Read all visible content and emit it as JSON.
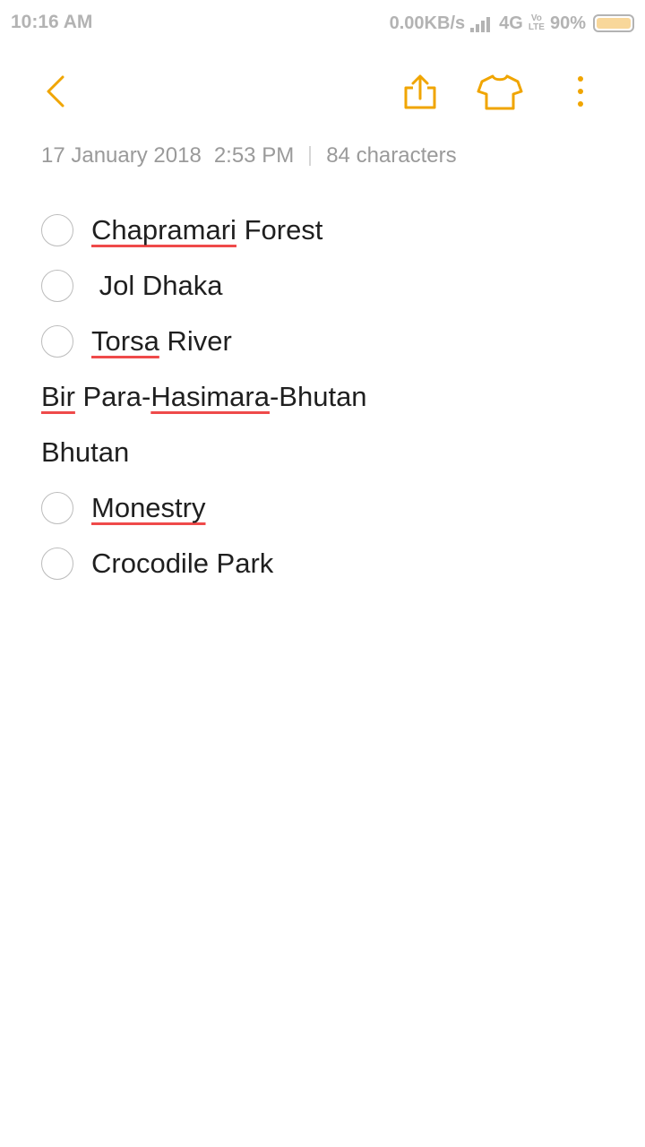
{
  "status_bar": {
    "time": "10:16 AM",
    "speed": "0.00KB/s",
    "network": "4G",
    "volte_top": "Vo",
    "volte_bottom": "LTE",
    "battery_percent": "90%",
    "battery_level": 0.9
  },
  "toolbar": {
    "icons": [
      "back-chevron-icon",
      "share-icon",
      "tshirt-theme-icon",
      "more-vertical-icon"
    ],
    "accent_color": "#f0a500"
  },
  "note": {
    "date": "17 January 2018",
    "time": "2:53 PM",
    "char_count": "84 characters",
    "items": [
      {
        "checkbox": true,
        "parts": [
          {
            "text": "Chapramari",
            "misspelled": true
          },
          {
            "text": " Forest",
            "misspelled": false
          }
        ]
      },
      {
        "checkbox": true,
        "parts": [
          {
            "text": " Jol Dhaka",
            "misspelled": false
          }
        ]
      },
      {
        "checkbox": true,
        "parts": [
          {
            "text": "Torsa",
            "misspelled": true
          },
          {
            "text": " River",
            "misspelled": false
          }
        ]
      },
      {
        "checkbox": false,
        "parts": [
          {
            "text": "Bir",
            "misspelled": true
          },
          {
            "text": " Para-",
            "misspelled": false
          },
          {
            "text": "Hasimara",
            "misspelled": true
          },
          {
            "text": "-Bhutan",
            "misspelled": false
          }
        ]
      },
      {
        "checkbox": false,
        "parts": [
          {
            "text": "Bhutan",
            "misspelled": false
          }
        ]
      },
      {
        "checkbox": true,
        "parts": [
          {
            "text": "Monestry",
            "misspelled": true
          }
        ]
      },
      {
        "checkbox": true,
        "parts": [
          {
            "text": "Crocodile Park",
            "misspelled": false
          }
        ]
      }
    ]
  }
}
